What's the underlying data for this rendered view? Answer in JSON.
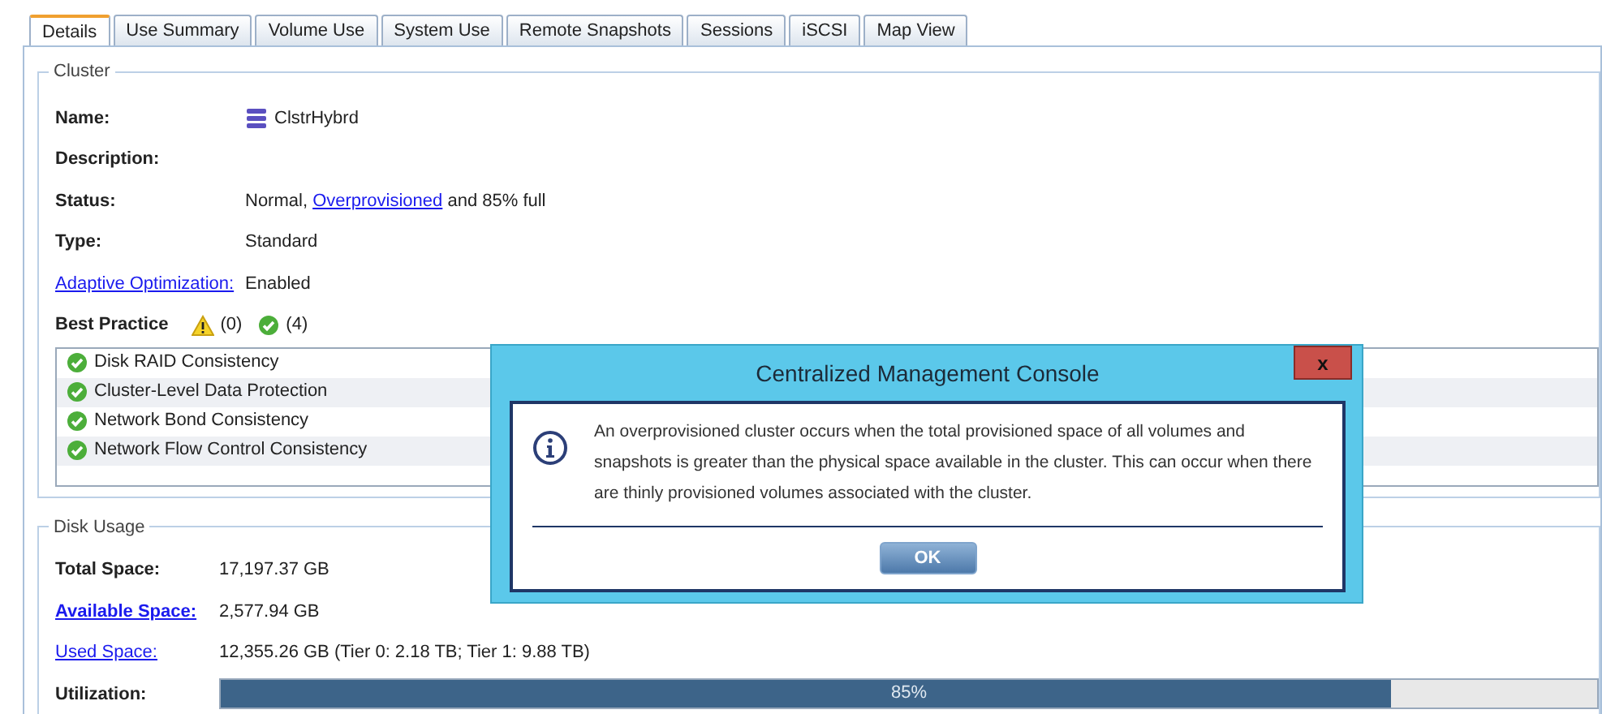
{
  "tabs": [
    {
      "label": "Details",
      "selected": true
    },
    {
      "label": "Use Summary",
      "selected": false
    },
    {
      "label": "Volume Use",
      "selected": false
    },
    {
      "label": "System Use",
      "selected": false
    },
    {
      "label": "Remote Snapshots",
      "selected": false
    },
    {
      "label": "Sessions",
      "selected": false
    },
    {
      "label": "iSCSI",
      "selected": false
    },
    {
      "label": "Map View",
      "selected": false
    }
  ],
  "cluster": {
    "legend": "Cluster",
    "fields": [
      {
        "label": "Name:",
        "kind": "name",
        "value": "ClstrHybrd"
      },
      {
        "label": "Description:",
        "kind": "plain"
      },
      {
        "label": "Status:",
        "kind": "status",
        "parts": [
          {
            "kind": "text",
            "text": "Normal, "
          },
          {
            "kind": "link",
            "text": "Overprovisioned"
          },
          {
            "kind": "text",
            "text": " and 85% full"
          }
        ]
      },
      {
        "label": "Type:",
        "kind": "plain",
        "value": "Standard"
      },
      {
        "label": "Adaptive Optimization:",
        "kind": "link-label",
        "value": "Enabled"
      }
    ],
    "best_practice": {
      "label": "Best Practice",
      "warning_count": "(0)",
      "ok_count": "(4)",
      "items": [
        {
          "label": "Disk RAID Consistency",
          "kind": "pass"
        },
        {
          "label": "Cluster-Level Data Protection",
          "kind": "pass"
        },
        {
          "label": "Network Bond Consistency",
          "kind": "pass"
        },
        {
          "label": "Network Flow Control Consistency",
          "kind": "pass"
        }
      ]
    }
  },
  "disk_usage": {
    "legend": "Disk Usage",
    "fields": [
      {
        "label": "Total Space:",
        "kind": "plain",
        "value": "17,197.37 GB"
      },
      {
        "label": "Available Space:",
        "kind": "bold-link",
        "value": "2,577.94 GB"
      },
      {
        "label": "Used Space:",
        "kind": "link-label",
        "value": "12,355.26 GB (Tier 0: 2.18 TB; Tier 1: 9.88 TB)"
      }
    ],
    "utilization": {
      "label": "Utilization:",
      "level": 0.85,
      "reading": "85%"
    }
  },
  "dialog": {
    "title": "Centralized Management Console",
    "close": "x",
    "message": "An overprovisioned cluster occurs when the total provisioned space of all volumes and snapshots is greater than the physical space available in the cluster. This can occur when there are thinly provisioned volumes associated with the cluster.",
    "button": "OK"
  }
}
